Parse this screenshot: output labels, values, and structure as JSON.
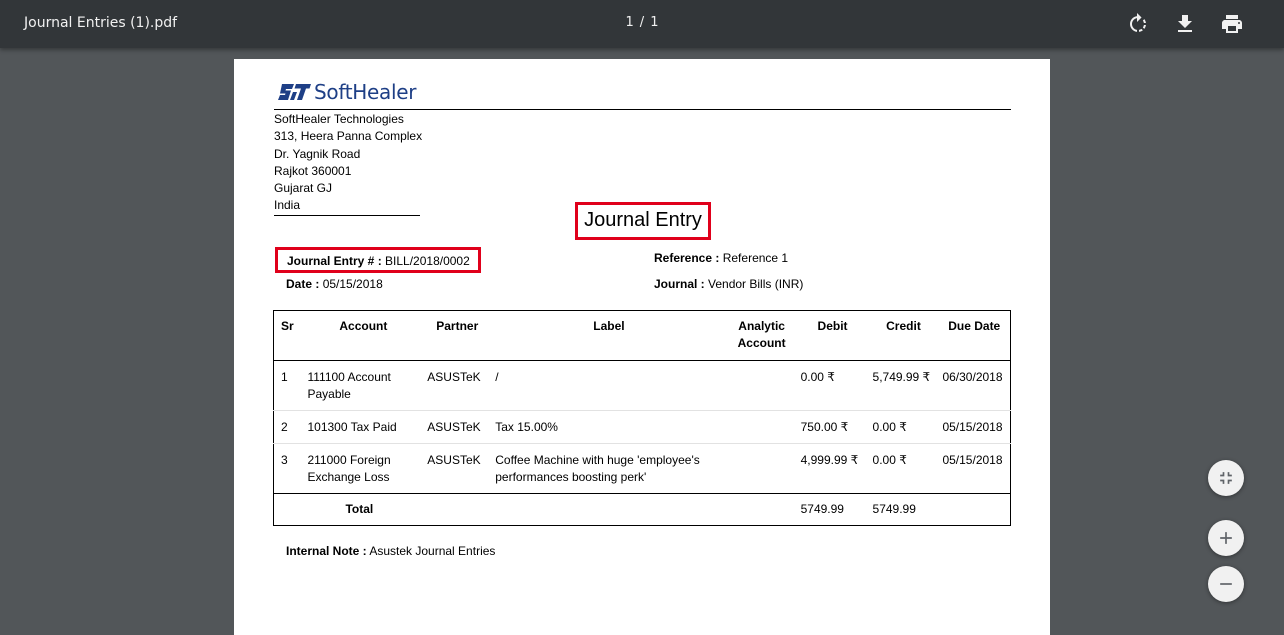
{
  "viewer": {
    "file_title": "Journal Entries (1).pdf",
    "current_page": "1",
    "page_separator": "/",
    "total_pages": "1"
  },
  "document": {
    "company_logo_text": "SoftHealer",
    "address_lines": [
      "SoftHealer Technologies",
      "313, Heera Panna Complex",
      "Dr. Yagnik Road",
      "Rajkot 360001",
      "Gujarat GJ",
      "India"
    ],
    "title": "Journal Entry",
    "journal_entry_label": "Journal Entry # :",
    "journal_entry_value": "BILL/2018/0002",
    "date_label": "Date :",
    "date_value": "05/15/2018",
    "reference_label": "Reference :",
    "reference_value": "Reference 1",
    "journal_label": "Journal :",
    "journal_value": "Vendor Bills (INR)",
    "table": {
      "headers": [
        "Sr",
        "Account",
        "Partner",
        "Label",
        "Analytic Account",
        "Debit",
        "Credit",
        "Due Date"
      ],
      "rows": [
        {
          "sr": "1",
          "account": "111100 Account Payable",
          "partner": "ASUSTeK",
          "label": "/",
          "analytic": "",
          "debit": "0.00 ₹",
          "credit": "5,749.99 ₹",
          "due": "06/30/2018"
        },
        {
          "sr": "2",
          "account": "101300 Tax Paid",
          "partner": "ASUSTeK",
          "label": "Tax 15.00%",
          "analytic": "",
          "debit": "750.00 ₹",
          "credit": "0.00 ₹",
          "due": "05/15/2018"
        },
        {
          "sr": "3",
          "account": "211000 Foreign Exchange Loss",
          "partner": "ASUSTeK",
          "label": "Coffee Machine with huge 'employee's performances boosting perk'",
          "analytic": "",
          "debit": "4,999.99 ₹",
          "credit": "0.00 ₹",
          "due": "05/15/2018"
        }
      ],
      "total_label": "Total",
      "total_debit": "5749.99",
      "total_credit": "5749.99"
    },
    "internal_note_label": "Internal Note :",
    "internal_note_value": "Asustek Journal Entries"
  },
  "colors": {
    "toolbar_bg": "#323639",
    "viewer_bg": "#525659",
    "highlight_border": "#e0001b",
    "logo_blue": "#1e3f86"
  },
  "icons": {
    "rotate": "rotate-icon",
    "download": "download-icon",
    "print": "print-icon",
    "fit": "fit-to-page-icon",
    "zoom_in": "zoom-in-icon",
    "zoom_out": "zoom-out-icon"
  }
}
